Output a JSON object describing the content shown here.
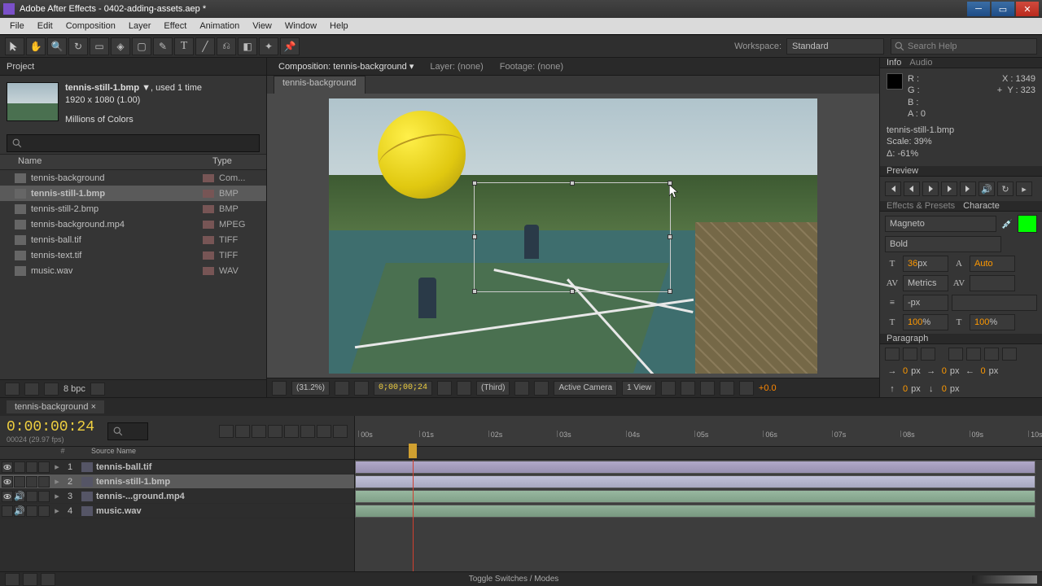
{
  "titlebar": {
    "title": "Adobe After Effects - 0402-adding-assets.aep *"
  },
  "menubar": {
    "items": [
      "File",
      "Edit",
      "Composition",
      "Layer",
      "Effect",
      "Animation",
      "View",
      "Window",
      "Help"
    ]
  },
  "workspace": {
    "label": "Workspace:",
    "selected": "Standard"
  },
  "search": {
    "placeholder": "Search Help"
  },
  "project": {
    "tab": "Project",
    "selected_name": "tennis-still-1.bmp ▼",
    "selected_usage": ", used 1 time",
    "selected_dims": "1920 x 1080 (1.00)",
    "selected_colors": "Millions of Colors",
    "col_name": "Name",
    "col_type": "Type",
    "items": [
      {
        "name": "tennis-background",
        "type": "Com..."
      },
      {
        "name": "tennis-still-1.bmp",
        "type": "BMP",
        "sel": true
      },
      {
        "name": "tennis-still-2.bmp",
        "type": "BMP"
      },
      {
        "name": "tennis-background.mp4",
        "type": "MPEG"
      },
      {
        "name": "tennis-ball.tif",
        "type": "TIFF"
      },
      {
        "name": "tennis-text.tif",
        "type": "TIFF"
      },
      {
        "name": "music.wav",
        "type": "WAV"
      }
    ],
    "bpc": "8 bpc"
  },
  "comp": {
    "header_label": "Composition:",
    "header_name": "tennis-background",
    "layer_label": "Layer: (none)",
    "footage_label": "Footage: (none)",
    "sub_tab": "tennis-background",
    "zoom": "(31.2%)",
    "timecode": "0;00;00;24",
    "quality": "(Third)",
    "camera": "Active Camera",
    "view": "1 View",
    "exposure": "+0.0"
  },
  "info": {
    "tab1": "Info",
    "tab2": "Audio",
    "r": "R :",
    "g": "G :",
    "b": "B :",
    "a": "A :  0",
    "x": "X : 1349",
    "y": "Y : 323",
    "name": "tennis-still-1.bmp",
    "scale": "Scale: 39%",
    "delta": "Δ: -61%"
  },
  "preview": {
    "tab": "Preview"
  },
  "effects": {
    "tab1": "Effects & Presets",
    "tab2": "Characte"
  },
  "char": {
    "font": "Magneto",
    "style": "Bold",
    "size": "36",
    "size_unit": " px",
    "leading": "Auto",
    "kerning": "Metrics",
    "tracking": "",
    "pxunit": "px",
    "scal_h": "100",
    "scal_v": "100",
    "pct": " %"
  },
  "paragraph": {
    "tab": "Paragraph",
    "px_val": "0",
    "px_unit": " px"
  },
  "timeline": {
    "tab": "tennis-background",
    "timecode": "0:00:00:24",
    "sub": "00024 (29.97 fps)",
    "col_num": "#",
    "col_src": "Source Name",
    "ticks": [
      "00s",
      "01s",
      "02s",
      "03s",
      "04s",
      "05s",
      "06s",
      "07s",
      "08s",
      "09s",
      "10s"
    ],
    "layers": [
      {
        "num": "1",
        "name": "tennis-ball.tif",
        "eye": true
      },
      {
        "num": "2",
        "name": "tennis-still-1.bmp",
        "eye": true,
        "sel": true
      },
      {
        "num": "3",
        "name": "tennis-...ground.mp4",
        "eye": true,
        "speaker": true
      },
      {
        "num": "4",
        "name": "music.wav",
        "speaker": true
      }
    ],
    "toggle": "Toggle Switches / Modes"
  }
}
